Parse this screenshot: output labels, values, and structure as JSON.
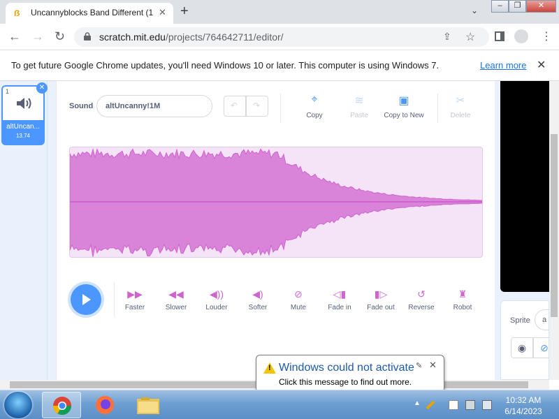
{
  "browser": {
    "tab_title": "Uncannyblocks Band Different (1",
    "url_domain": "scratch.mit.edu",
    "url_path": "/projects/764642711/editor/",
    "infobar_message": "To get future Google Chrome updates, you'll need Windows 10 or later. This computer is using Windows 7.",
    "infobar_link": "Learn more"
  },
  "sound_list": {
    "items": [
      {
        "number": "1",
        "name": "altUncan...",
        "duration": "13.74"
      }
    ]
  },
  "sound_editor": {
    "sound_label": "Sound",
    "sound_name": "altUncanny!1M",
    "tools": [
      {
        "label": "Copy",
        "icon": "copy-icon",
        "enabled": true
      },
      {
        "label": "Paste",
        "icon": "paste-icon",
        "enabled": false
      },
      {
        "label": "Copy to New",
        "icon": "copy-to-new-icon",
        "enabled": true
      },
      {
        "label": "Delete",
        "icon": "scissors-icon",
        "enabled": false
      }
    ],
    "effects": [
      {
        "label": "Faster",
        "icon": "faster-icon"
      },
      {
        "label": "Slower",
        "icon": "slower-icon"
      },
      {
        "label": "Louder",
        "icon": "louder-icon"
      },
      {
        "label": "Softer",
        "icon": "softer-icon"
      },
      {
        "label": "Mute",
        "icon": "mute-icon"
      },
      {
        "label": "Fade in",
        "icon": "fade-in-icon"
      },
      {
        "label": "Fade out",
        "icon": "fade-out-icon"
      },
      {
        "label": "Reverse",
        "icon": "reverse-icon"
      },
      {
        "label": "Robot",
        "icon": "robot-icon"
      }
    ],
    "waveform_color": "#cf63cf",
    "waveform_bg": "#f5e4f8"
  },
  "stage_panel": {
    "sprite_label": "Sprite",
    "sprite_name_partial": "a"
  },
  "notification": {
    "title": "Windows could not activate",
    "body": "Click this message to find out more."
  },
  "taskbar": {
    "apps": [
      "chrome-icon",
      "firefox-icon",
      "file-explorer-icon"
    ],
    "time": "10:32 AM",
    "date": "6/14/2023"
  },
  "colors": {
    "scratch_blue": "#4c97ff",
    "scratch_magenta": "#cf63cf",
    "link_blue": "#1a73e8"
  }
}
